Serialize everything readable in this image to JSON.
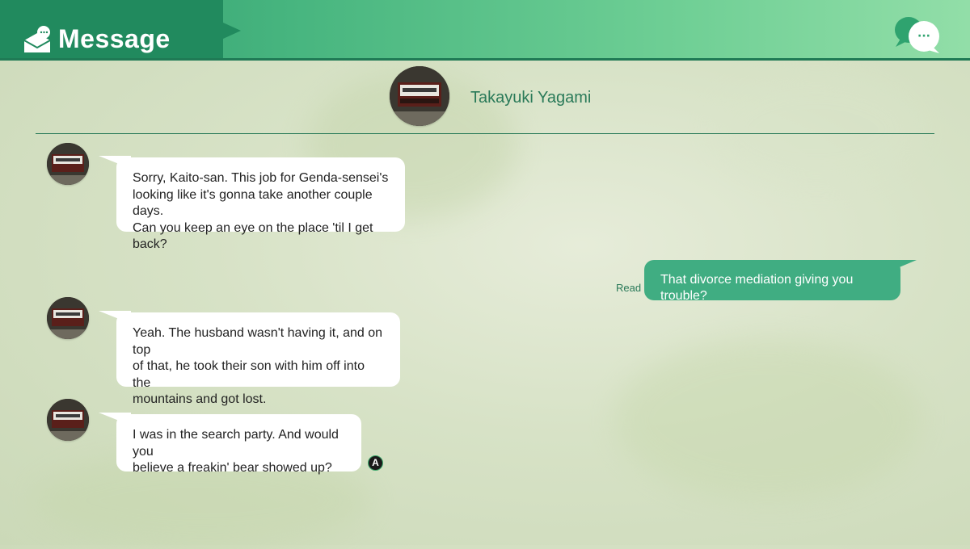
{
  "header": {
    "title": "Message",
    "app_icon": "message-envelope-icon",
    "chat_icon": "chat-bubble-dots-icon",
    "chat_icon_glyph": "···"
  },
  "contact": {
    "name": "Takayuki Yagami",
    "avatar": "yagami-detective-agency-sign"
  },
  "messages": [
    {
      "from": "contact",
      "text": "Sorry, Kaito-san. This job for Genda-sensei's\nlooking like it's gonna take another couple days.\nCan you keep an eye on the place 'til I get back?"
    },
    {
      "from": "player",
      "text": "That divorce mediation giving you trouble?",
      "status": "Read"
    },
    {
      "from": "contact",
      "text": "Yeah. The husband wasn't having it, and on top\nof that, he took their son with him off into the\nmountains and got lost."
    },
    {
      "from": "contact",
      "text": "I was in the search party. And would you\nbelieve a freakin' bear showed up?"
    }
  ],
  "prompt": {
    "button_label": "A",
    "icon": "a-button-icon"
  },
  "colors": {
    "header_dark": "#218a5e",
    "header_light": "#92dea8",
    "player_bubble": "#40ad82",
    "accent_text": "#2a7a59"
  }
}
